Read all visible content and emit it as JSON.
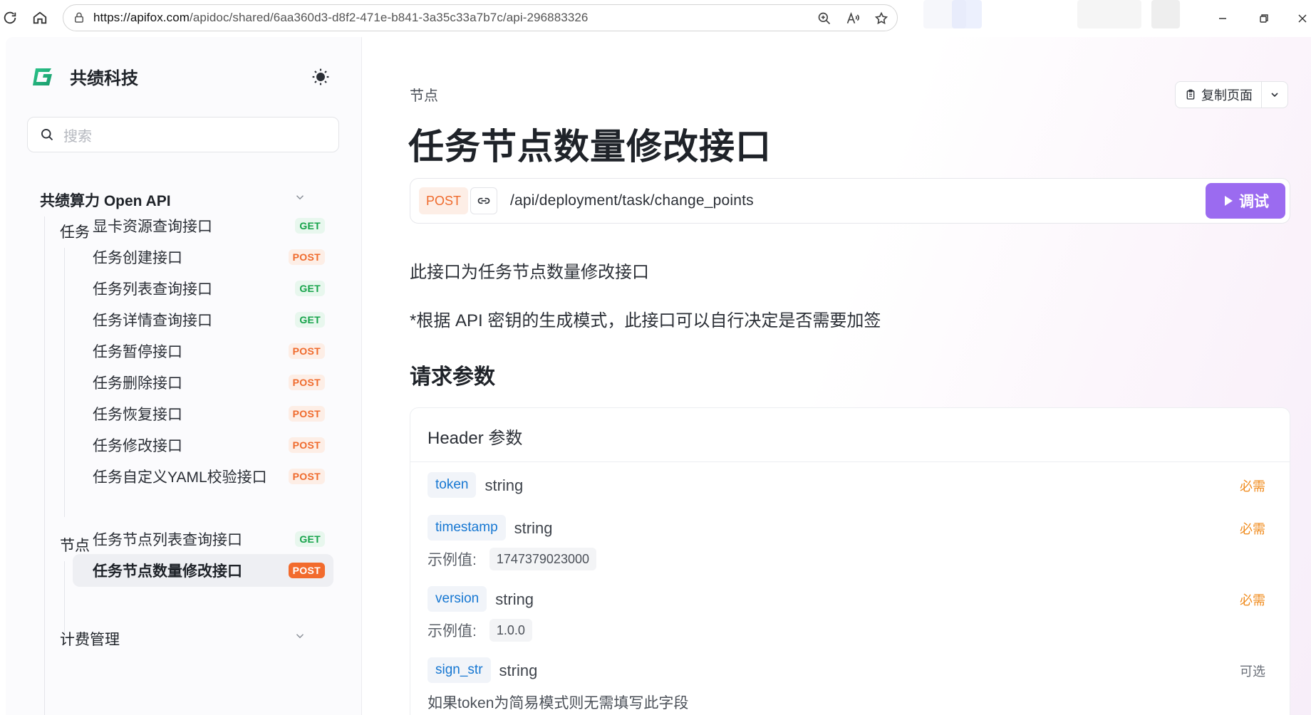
{
  "browser": {
    "url_host": "https://apifox.com",
    "url_path": "/apidoc/shared/6aa360d3-d8f2-471e-b841-3a35c33a7b7c/api-296883326"
  },
  "sidebar": {
    "brand_name": "共绩科技",
    "search_placeholder": "搜索",
    "root_label": "共绩算力 Open API",
    "group_task_label": "任务",
    "task_items": [
      {
        "label": "显卡资源查询接口",
        "method": "GET"
      },
      {
        "label": "任务创建接口",
        "method": "POST"
      },
      {
        "label": "任务列表查询接口",
        "method": "GET"
      },
      {
        "label": "任务详情查询接口",
        "method": "GET"
      },
      {
        "label": "任务暂停接口",
        "method": "POST"
      },
      {
        "label": "任务删除接口",
        "method": "POST"
      },
      {
        "label": "任务恢复接口",
        "method": "POST"
      },
      {
        "label": "任务修改接口",
        "method": "POST"
      },
      {
        "label": "任务自定义YAML校验接口",
        "method": "POST"
      }
    ],
    "group_node_label": "节点",
    "node_items": [
      {
        "label": "任务节点列表查询接口",
        "method": "GET"
      },
      {
        "label": "任务节点数量修改接口",
        "method": "POST"
      }
    ],
    "group_billing_label": "计费管理"
  },
  "main": {
    "breadcrumb": "节点",
    "copy_page_label": "复制页面",
    "title": "任务节点数量修改接口",
    "method": "POST",
    "path": "/api/deployment/task/change_points",
    "run_label": "调试",
    "description": "此接口为任务节点数量修改接口",
    "note": "*根据 API 密钥的生成模式，此接口可以自行决定是否需要加签",
    "section_title": "请求参数",
    "header_card_title": "Header 参数",
    "example_label": "示例值:",
    "params": [
      {
        "name": "token",
        "type": "string",
        "required": "必需"
      },
      {
        "name": "timestamp",
        "type": "string",
        "required": "必需",
        "example": "1747379023000"
      },
      {
        "name": "version",
        "type": "string",
        "required": "必需",
        "example": "1.0.0"
      },
      {
        "name": "sign_str",
        "type": "string",
        "required": "可选",
        "note": "如果token为简易模式则无需填写此字段"
      }
    ]
  },
  "colors": {
    "accent": "#9b6bf0",
    "get": "#16a34a",
    "post": "#ef6a2c",
    "required": "#f08c1f",
    "param_name": "#1677d2"
  }
}
